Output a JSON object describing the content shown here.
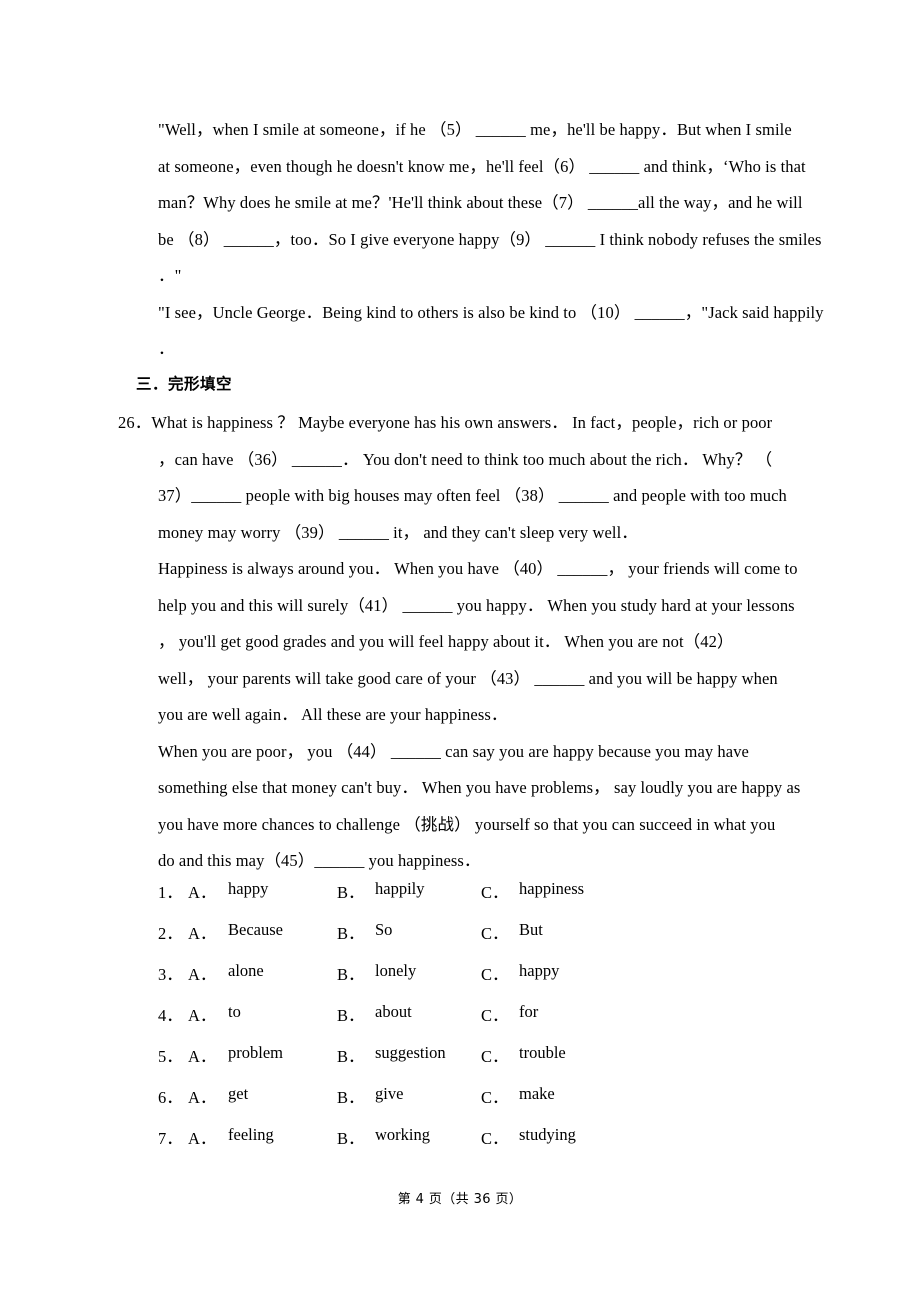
{
  "document": {
    "footer": "第 4 页（共 36 页）",
    "page_number": "4",
    "total_pages": "36"
  },
  "passage_top": {
    "lines": [
      "\"Well，when I smile at someone，if he （5） ______ me，he'll be happy．But when I smile",
      "at someone，even though he doesn't know me，he'll feel（6） ______ and think，‘Who is that",
      "man？Why does he smile at me？'He'll think about these（7） ______all the way，and he will",
      "be （8） ______，too．So I give everyone happy（9） ______ I think nobody refuses the smiles",
      "．\"",
      "\"I see，Uncle George．Being kind to others is also be kind to （10） ______，\"Jack said happily",
      "．"
    ]
  },
  "section": {
    "heading": "三．完形填空"
  },
  "cloze": {
    "number": "26．",
    "lines": [
      "What is happiness ？  Maybe everyone has his own answers．  In fact，people，rich or poor",
      "，can have （36） ______．  You don't need to think too much about the rich．  Why？ （",
      "37）______ people with big houses may often feel （38） ______ and people with too much",
      "money may worry （39） ______ it， and they can't sleep very well．",
      "Happiness is always around you．  When you have （40） ______， your friends will come to",
      "help you and this will surely（41） ______ you happy．  When you study hard at your lessons",
      "， you'll get good grades and you will feel happy about it．  When you are not（42）",
      "well， your parents will take good care of your （43） ______ and you will be happy when",
      "you are well again．  All these are your happiness．",
      "When you are poor， you （44） ______ can say you are happy because you may have",
      "something else that money can't buy．  When you have problems， say loudly you are happy as",
      "you have more chances to challenge （挑战） yourself so that you can succeed in what you",
      "do and this may（45）______ you happiness．"
    ]
  },
  "options": {
    "rows": [
      {
        "num": "1．",
        "a_key": "A．",
        "a": "happy",
        "b_key": "B．",
        "b": "happily",
        "c_key": "C．",
        "c": "happiness"
      },
      {
        "num": "2．",
        "a_key": "A．",
        "a": "Because",
        "b_key": "B．",
        "b": "So",
        "c_key": "C．",
        "c": "But"
      },
      {
        "num": "3．",
        "a_key": "A．",
        "a": "alone",
        "b_key": "B．",
        "b": "lonely",
        "c_key": "C．",
        "c": "happy"
      },
      {
        "num": "4．",
        "a_key": "A．",
        "a": "to",
        "b_key": "B．",
        "b": "about",
        "c_key": "C．",
        "c": "for"
      },
      {
        "num": "5．",
        "a_key": "A．",
        "a": "problem",
        "b_key": "B．",
        "b": "suggestion",
        "c_key": "C．",
        "c": "trouble"
      },
      {
        "num": "6．",
        "a_key": "A．",
        "a": "get",
        "b_key": "B．",
        "b": "give",
        "c_key": "C．",
        "c": "make"
      },
      {
        "num": "7．",
        "a_key": "A．",
        "a": "feeling",
        "b_key": "B．",
        "b": "working",
        "c_key": "C．",
        "c": "studying"
      }
    ]
  }
}
